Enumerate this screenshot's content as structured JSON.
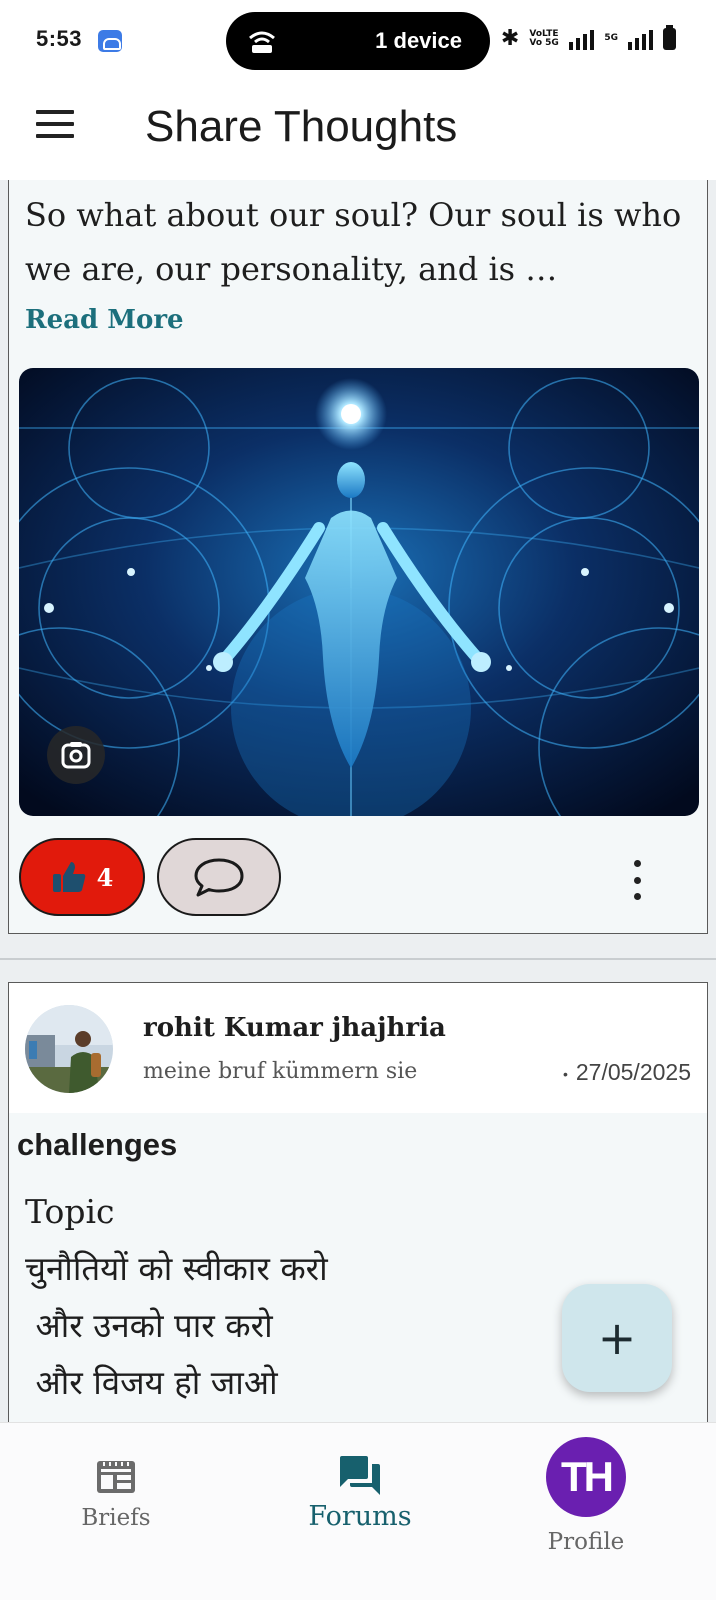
{
  "status_bar": {
    "time": "5:53",
    "device_pill_text": "1 device",
    "volte_text": "VoLTE Vo 5G",
    "network": "5G"
  },
  "app_bar": {
    "title": "Share Thoughts",
    "menu_icon": "hamburger-menu-icon"
  },
  "post1": {
    "text": "So what about our soul? Our soul is who we are, our personality, and is …",
    "read_more": "Read More",
    "image_icon": "lens-search-icon",
    "likes": "4",
    "like_color": "#e11a0c"
  },
  "post2": {
    "author": "rohit Kumar jhajhria",
    "bio": "meine bruf kümmern sie",
    "date": "27/05/2025",
    "title": "challenges",
    "body": "Topic\nचुनौतियों को स्वीकार करो\n और उनको पार करो\n और विजय हो जाओ"
  },
  "fab": {
    "icon": "plus-icon"
  },
  "bottom_nav": {
    "items": [
      {
        "label": "Briefs",
        "icon": "briefs-icon",
        "active": false
      },
      {
        "label": "Forums",
        "icon": "forums-icon",
        "active": true
      },
      {
        "label": "Profile",
        "icon": "profile-avatar",
        "active": false
      }
    ],
    "profile_initials": "TH",
    "active_color": "#17606d",
    "profile_color": "#6a1fb0"
  }
}
